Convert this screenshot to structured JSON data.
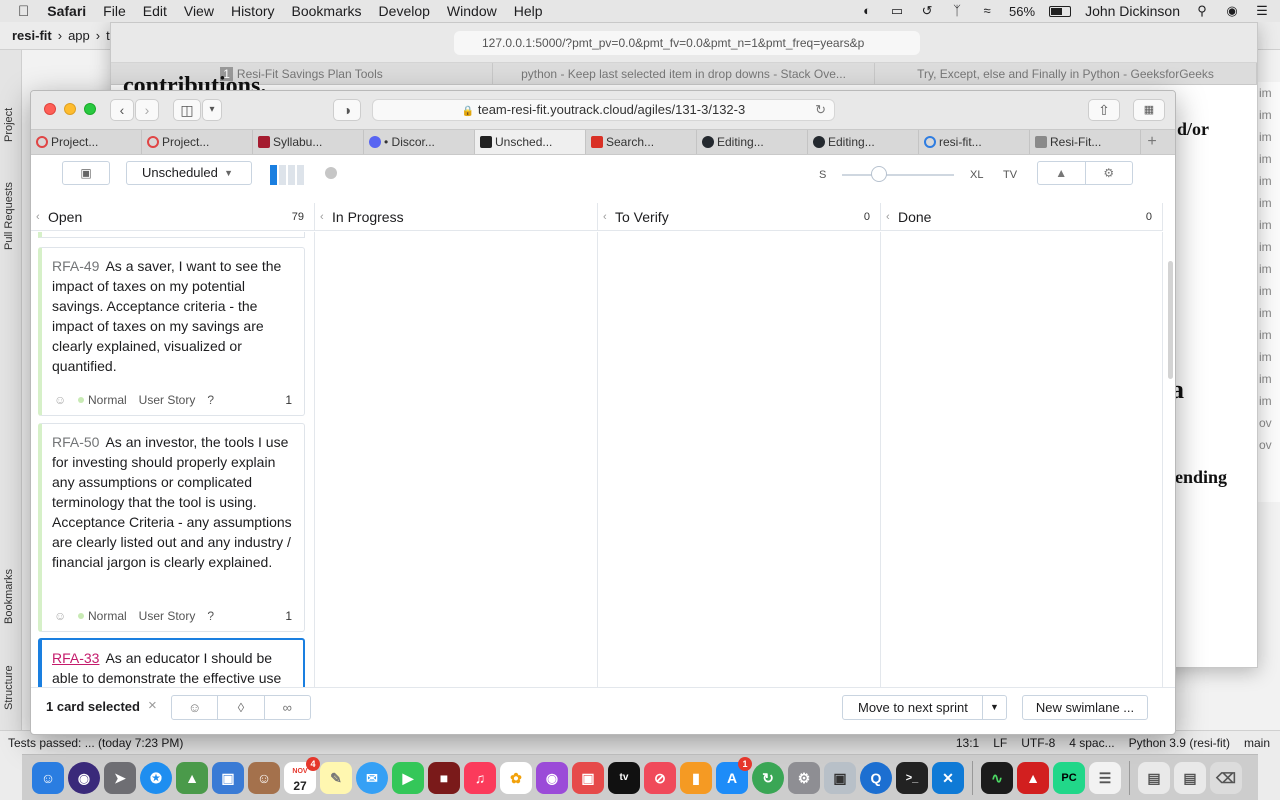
{
  "menubar": {
    "app": "Safari",
    "items": [
      "File",
      "Edit",
      "View",
      "History",
      "Bookmarks",
      "Develop",
      "Window",
      "Help"
    ],
    "battery": "56%",
    "user": "John Dickinson"
  },
  "ide": {
    "breadcrumb": [
      "resi-fit",
      "app",
      "te"
    ],
    "left_tabs": [
      "Project",
      "Pull Requests",
      "Bookmarks",
      "Structure"
    ],
    "status_left": "Tests passed: ... (today 7:23 PM)",
    "status_right": [
      "13:1",
      "LF",
      "UTF-8",
      "4 spac...",
      "Python 3.9 (resi-fit)",
      "main"
    ],
    "editor_strip": [
      "im",
      "im",
      "im",
      "im",
      "im",
      "im",
      "im",
      "im",
      "im",
      "im",
      "im",
      "im",
      "im",
      "im",
      "im",
      "ov",
      "ov"
    ]
  },
  "bg_safari": {
    "url": "127.0.0.1:5000/?pmt_pv=0.0&pmt_fv=0.0&pmt_n=1&pmt_freq=years&p",
    "tabs": [
      "Resi-Fit Savings Plan Tools",
      "python - Keep last selected item in drop downs - Stack Ove...",
      "Try, Except, else and Finally in Python - GeeksforGeeks"
    ],
    "tab_badge": "1",
    "texts": [
      "contributions.",
      "d/or",
      "a",
      "ending"
    ]
  },
  "fg_safari": {
    "url": "team-resi-fit.youtrack.cloud/agiles/131-3/132-3",
    "tabs": [
      {
        "label": "Project...",
        "color": "#e04545"
      },
      {
        "label": "Project...",
        "color": "#e04545"
      },
      {
        "label": "Syllabu...",
        "color": "#a51c30"
      },
      {
        "label": "• Discor...",
        "color": "#5865f2"
      },
      {
        "label": "Unsched...",
        "color": "#222222"
      },
      {
        "label": "Search...",
        "color": "#d93025"
      },
      {
        "label": "Editing...",
        "color": "#24292f"
      },
      {
        "label": "Editing...",
        "color": "#24292f"
      },
      {
        "label": "resi-fit...",
        "color": "#2f7de1"
      },
      {
        "label": "Resi-Fit...",
        "color": "#8a8a8a"
      }
    ],
    "tab_add": "+"
  },
  "board": {
    "sprint": "Unscheduled",
    "size_small": "S",
    "size_large": "XL",
    "tv_label": "TV",
    "columns": [
      {
        "name": "Open",
        "count": "79"
      },
      {
        "name": "In Progress",
        "count": ""
      },
      {
        "name": "To Verify",
        "count": "0"
      },
      {
        "name": "Done",
        "count": "0"
      }
    ],
    "cards": [
      {
        "id": "RFA-49",
        "summary": "As a saver, I want to see the impact of taxes on my potential savings. Acceptance criteria - the impact of taxes on my savings are clearly explained, visualized or quantified.",
        "priority": "Normal",
        "type": "User Story",
        "estimate": "?",
        "points": "1"
      },
      {
        "id": "RFA-50",
        "summary": "As an investor, the tools I use for investing should properly explain any assumptions or complicated terminology that the tool is using. Acceptance Criteria - any assumptions are clearly listed out and any industry / financial jargon is clearly explained.",
        "priority": "Normal",
        "type": "User Story",
        "estimate": "?",
        "points": "1"
      },
      {
        "id": "RFA-33",
        "summary": "As an educator I should be able to demonstrate the effective use"
      }
    ],
    "selection": {
      "label": "1 card selected",
      "clear": "×"
    },
    "move_button": "Move to next sprint",
    "swimlane_button": "New swimlane ..."
  },
  "dock": {
    "calendar_day": "27",
    "calendar_month": "NOV",
    "calendar_badge": "4",
    "appstore_badge": "1"
  }
}
